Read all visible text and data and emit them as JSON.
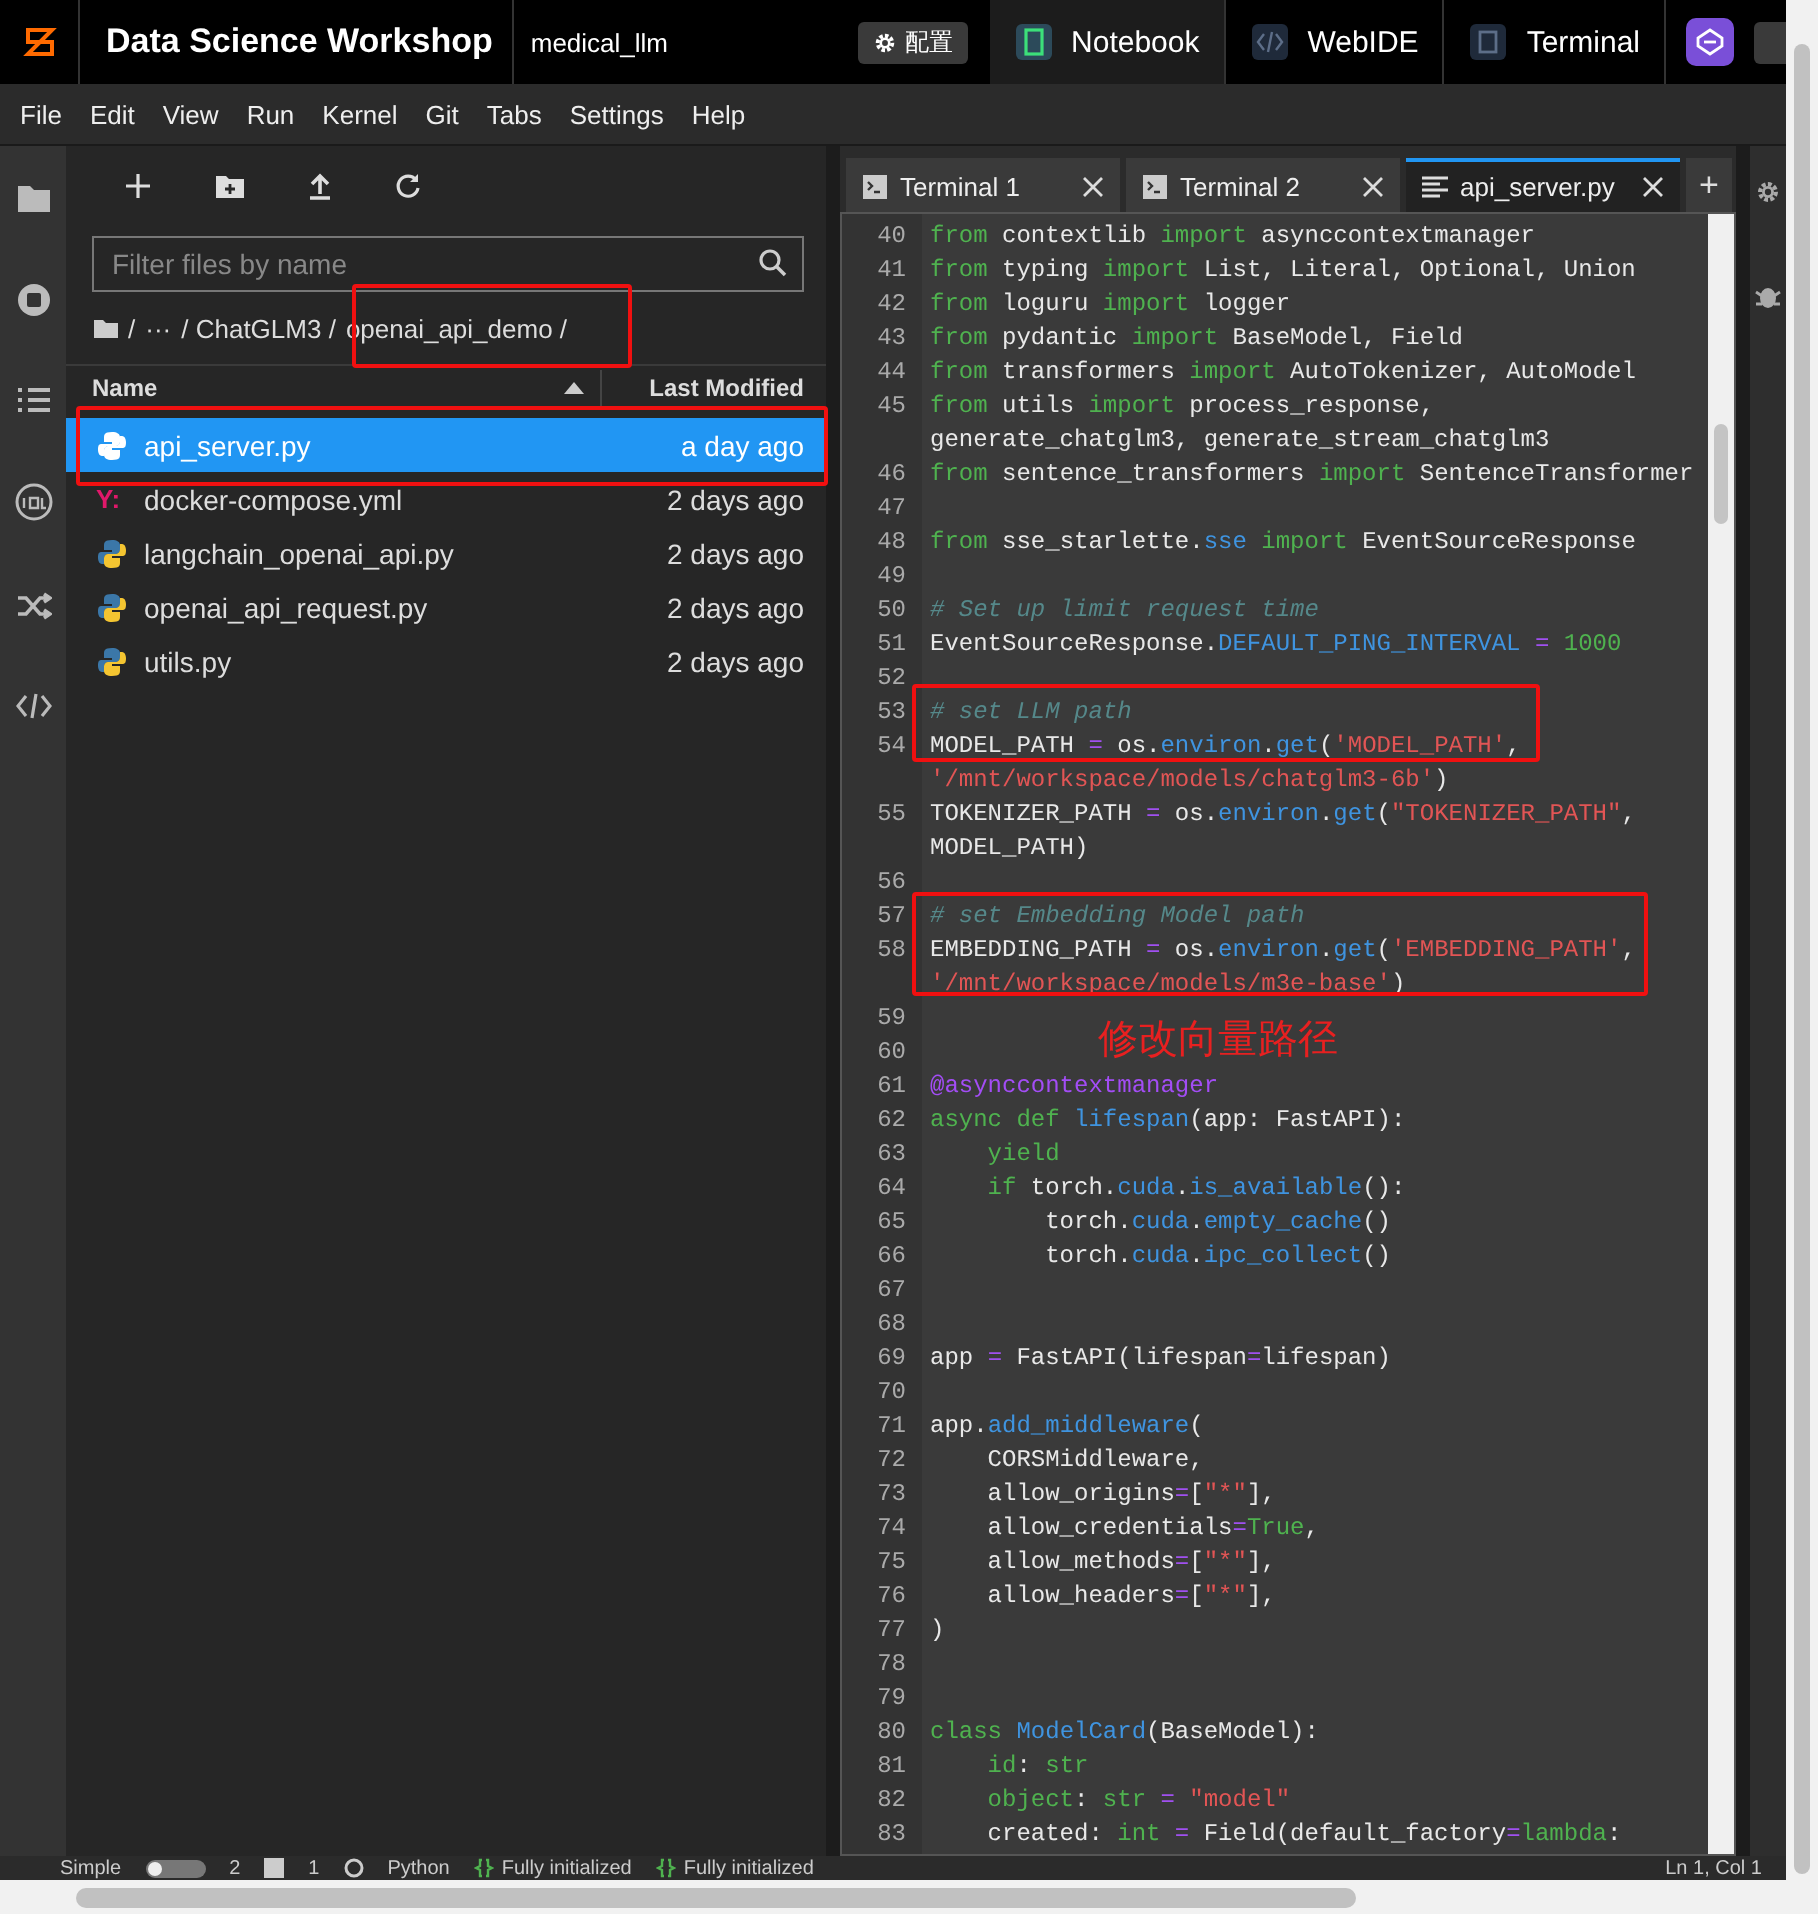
{
  "top_bar": {
    "title": "Data Science Workshop",
    "workspace": "medical_llm",
    "config_button": "配置",
    "tabs": [
      {
        "label": "Notebook",
        "kind": "notebook",
        "selected": true
      },
      {
        "label": "WebIDE",
        "kind": "webide",
        "selected": false
      },
      {
        "label": "Terminal",
        "kind": "terminal",
        "selected": false
      }
    ]
  },
  "menu": [
    "File",
    "Edit",
    "View",
    "Run",
    "Kernel",
    "Git",
    "Tabs",
    "Settings",
    "Help"
  ],
  "file_browser": {
    "filter": {
      "placeholder": "Filter files by name"
    },
    "breadcrumb": [
      "/",
      "···",
      "/ ChatGLM3 /",
      "openai_api_demo /"
    ],
    "columns": [
      "Name",
      "Last Modified"
    ],
    "files": [
      {
        "name": "api_server.py",
        "kind": "python",
        "modified": "a day ago",
        "selected": true
      },
      {
        "name": "docker-compose.yml",
        "kind": "yaml",
        "icon_glyph": "Y:",
        "modified": "2 days ago",
        "selected": false
      },
      {
        "name": "langchain_openai_api.py",
        "kind": "python",
        "modified": "2 days ago",
        "selected": false
      },
      {
        "name": "openai_api_request.py",
        "kind": "python",
        "modified": "2 days ago",
        "selected": false
      },
      {
        "name": "utils.py",
        "kind": "python",
        "modified": "2 days ago",
        "selected": false
      }
    ]
  },
  "editor": {
    "tabs": [
      {
        "label": "Terminal 1",
        "kind": "terminal",
        "selected": false
      },
      {
        "label": "Terminal 2",
        "kind": "terminal",
        "selected": false
      },
      {
        "label": "api_server.py",
        "kind": "file",
        "selected": true
      }
    ],
    "new_tab": "+",
    "lines": [
      {
        "number": "40",
        "tokens": [
          {
            "kind": "kw",
            "text": "from"
          },
          {
            "kind": "p",
            "text": " contextlib "
          },
          {
            "kind": "kw",
            "text": "import"
          },
          {
            "kind": "p",
            "text": " asynccontextmanager"
          }
        ]
      },
      {
        "number": "41",
        "tokens": [
          {
            "kind": "kw",
            "text": "from"
          },
          {
            "kind": "p",
            "text": " typing "
          },
          {
            "kind": "kw",
            "text": "import"
          },
          {
            "kind": "p",
            "text": " List, Literal, Optional, Union"
          }
        ]
      },
      {
        "number": "42",
        "tokens": [
          {
            "kind": "kw",
            "text": "from"
          },
          {
            "kind": "p",
            "text": " loguru "
          },
          {
            "kind": "kw",
            "text": "import"
          },
          {
            "kind": "p",
            "text": " logger"
          }
        ]
      },
      {
        "number": "43",
        "tokens": [
          {
            "kind": "kw",
            "text": "from"
          },
          {
            "kind": "p",
            "text": " pydantic "
          },
          {
            "kind": "kw",
            "text": "import"
          },
          {
            "kind": "p",
            "text": " BaseModel, Field"
          }
        ]
      },
      {
        "number": "44",
        "tokens": [
          {
            "kind": "kw",
            "text": "from"
          },
          {
            "kind": "p",
            "text": " transformers "
          },
          {
            "kind": "kw",
            "text": "import"
          },
          {
            "kind": "p",
            "text": " AutoTokenizer, AutoModel"
          }
        ]
      },
      {
        "number": "45",
        "tokens": [
          {
            "kind": "kw",
            "text": "from"
          },
          {
            "kind": "p",
            "text": " utils "
          },
          {
            "kind": "kw",
            "text": "import"
          },
          {
            "kind": "p",
            "text": " process_response,"
          }
        ]
      },
      {
        "tokens": [
          {
            "kind": "p",
            "text": "generate_chatglm3, generate_stream_chatglm3"
          }
        ]
      },
      {
        "number": "46",
        "tokens": [
          {
            "kind": "kw",
            "text": "from"
          },
          {
            "kind": "p",
            "text": " sentence_transformers "
          },
          {
            "kind": "kw",
            "text": "import"
          },
          {
            "kind": "p",
            "text": " SentenceTransformer"
          }
        ]
      },
      {
        "number": "47"
      },
      {
        "number": "48",
        "tokens": [
          {
            "kind": "kw",
            "text": "from"
          },
          {
            "kind": "p",
            "text": " sse_starlette."
          },
          {
            "kind": "attr",
            "text": "sse"
          },
          {
            "kind": "kw",
            "text": " import"
          },
          {
            "kind": "p",
            "text": " EventSourceResponse"
          }
        ]
      },
      {
        "number": "49"
      },
      {
        "number": "50",
        "tokens": [
          {
            "kind": "cm",
            "text": "# Set up limit request time"
          }
        ]
      },
      {
        "number": "51",
        "tokens": [
          {
            "kind": "p",
            "text": "EventSourceResponse."
          },
          {
            "kind": "attr",
            "text": "DEFAULT_PING_INTERVAL"
          },
          {
            "kind": "op",
            "text": " ="
          },
          {
            "kind": "num",
            "text": " 1000"
          }
        ]
      },
      {
        "number": "52"
      },
      {
        "number": "53",
        "tokens": [
          {
            "kind": "cm",
            "text": "# set LLM path"
          }
        ]
      },
      {
        "number": "54",
        "tokens": [
          {
            "kind": "p",
            "text": "MODEL_PATH "
          },
          {
            "kind": "op",
            "text": "="
          },
          {
            "kind": "p",
            "text": " os."
          },
          {
            "kind": "attr",
            "text": "environ"
          },
          {
            "kind": "p",
            "text": "."
          },
          {
            "kind": "attr",
            "text": "get"
          },
          {
            "kind": "p",
            "text": "("
          },
          {
            "kind": "str",
            "text": "'MODEL_PATH'"
          },
          {
            "kind": "p",
            "text": ","
          }
        ]
      },
      {
        "tokens": [
          {
            "kind": "str",
            "text": "'/mnt/workspace/models/chatglm3-6b'"
          },
          {
            "kind": "p",
            "text": ")"
          }
        ]
      },
      {
        "number": "55",
        "tokens": [
          {
            "kind": "p",
            "text": "TOKENIZER_PATH "
          },
          {
            "kind": "op",
            "text": "="
          },
          {
            "kind": "p",
            "text": " os."
          },
          {
            "kind": "attr",
            "text": "environ"
          },
          {
            "kind": "p",
            "text": "."
          },
          {
            "kind": "attr",
            "text": "get"
          },
          {
            "kind": "p",
            "text": "("
          },
          {
            "kind": "str",
            "text": "\"TOKENIZER_PATH\""
          },
          {
            "kind": "p",
            "text": ","
          }
        ]
      },
      {
        "tokens": [
          {
            "kind": "p",
            "text": "MODEL_PATH)"
          }
        ]
      },
      {
        "number": "56"
      },
      {
        "number": "57",
        "tokens": [
          {
            "kind": "cm",
            "text": "# set Embedding Model path"
          }
        ]
      },
      {
        "number": "58",
        "tokens": [
          {
            "kind": "p",
            "text": "EMBEDDING_PATH "
          },
          {
            "kind": "op",
            "text": "="
          },
          {
            "kind": "p",
            "text": " os."
          },
          {
            "kind": "attr",
            "text": "environ"
          },
          {
            "kind": "p",
            "text": "."
          },
          {
            "kind": "attr",
            "text": "get"
          },
          {
            "kind": "p",
            "text": "("
          },
          {
            "kind": "str",
            "text": "'EMBEDDING_PATH'"
          },
          {
            "kind": "p",
            "text": ","
          }
        ]
      },
      {
        "tokens": [
          {
            "kind": "str",
            "text": "'/mnt/workspace/models/m3e-base'"
          },
          {
            "kind": "p",
            "text": ")"
          }
        ]
      },
      {
        "number": "59"
      },
      {
        "number": "60"
      },
      {
        "number": "61",
        "tokens": [
          {
            "kind": "deco",
            "text": "@asynccontextmanager"
          }
        ]
      },
      {
        "number": "62",
        "tokens": [
          {
            "kind": "kw",
            "text": "async def"
          },
          {
            "kind": "attr",
            "text": " lifespan"
          },
          {
            "kind": "p",
            "text": "(app: FastAPI):"
          }
        ]
      },
      {
        "number": "63",
        "tokens": [
          {
            "kind": "kw",
            "text": "    yield"
          }
        ]
      },
      {
        "number": "64",
        "tokens": [
          {
            "kind": "kw",
            "text": "    if"
          },
          {
            "kind": "p",
            "text": " torch."
          },
          {
            "kind": "attr",
            "text": "cuda"
          },
          {
            "kind": "p",
            "text": "."
          },
          {
            "kind": "attr",
            "text": "is_available"
          },
          {
            "kind": "p",
            "text": "():"
          }
        ]
      },
      {
        "number": "65",
        "tokens": [
          {
            "kind": "p",
            "text": "        torch."
          },
          {
            "kind": "attr",
            "text": "cuda"
          },
          {
            "kind": "p",
            "text": "."
          },
          {
            "kind": "attr",
            "text": "empty_cache"
          },
          {
            "kind": "p",
            "text": "()"
          }
        ]
      },
      {
        "number": "66",
        "tokens": [
          {
            "kind": "p",
            "text": "        torch."
          },
          {
            "kind": "attr",
            "text": "cuda"
          },
          {
            "kind": "p",
            "text": "."
          },
          {
            "kind": "attr",
            "text": "ipc_collect"
          },
          {
            "kind": "p",
            "text": "()"
          }
        ]
      },
      {
        "number": "67"
      },
      {
        "number": "68"
      },
      {
        "number": "69",
        "tokens": [
          {
            "kind": "p",
            "text": "app "
          },
          {
            "kind": "op",
            "text": "="
          },
          {
            "kind": "p",
            "text": " FastAPI(lifespan"
          },
          {
            "kind": "op",
            "text": "="
          },
          {
            "kind": "p",
            "text": "lifespan)"
          }
        ]
      },
      {
        "number": "70"
      },
      {
        "number": "71",
        "tokens": [
          {
            "kind": "p",
            "text": "app."
          },
          {
            "kind": "attr",
            "text": "add_middleware"
          },
          {
            "kind": "p",
            "text": "("
          }
        ]
      },
      {
        "number": "72",
        "tokens": [
          {
            "kind": "p",
            "text": "    CORSMiddleware,"
          }
        ]
      },
      {
        "number": "73",
        "tokens": [
          {
            "kind": "p",
            "text": "    allow_origins"
          },
          {
            "kind": "op",
            "text": "="
          },
          {
            "kind": "p",
            "text": "["
          },
          {
            "kind": "str",
            "text": "\"*\""
          },
          {
            "kind": "p",
            "text": "],"
          }
        ]
      },
      {
        "number": "74",
        "tokens": [
          {
            "kind": "p",
            "text": "    allow_credentials"
          },
          {
            "kind": "op",
            "text": "="
          },
          {
            "kind": "kw",
            "text": "True"
          },
          {
            "kind": "p",
            "text": ","
          }
        ]
      },
      {
        "number": "75",
        "tokens": [
          {
            "kind": "p",
            "text": "    allow_methods"
          },
          {
            "kind": "op",
            "text": "="
          },
          {
            "kind": "p",
            "text": "["
          },
          {
            "kind": "str",
            "text": "\"*\""
          },
          {
            "kind": "p",
            "text": "],"
          }
        ]
      },
      {
        "number": "76",
        "tokens": [
          {
            "kind": "p",
            "text": "    allow_headers"
          },
          {
            "kind": "op",
            "text": "="
          },
          {
            "kind": "p",
            "text": "["
          },
          {
            "kind": "str",
            "text": "\"*\""
          },
          {
            "kind": "p",
            "text": "],"
          }
        ]
      },
      {
        "number": "77",
        "tokens": [
          {
            "kind": "p",
            "text": ")"
          }
        ]
      },
      {
        "number": "78"
      },
      {
        "number": "79"
      },
      {
        "number": "80",
        "tokens": [
          {
            "kind": "kw",
            "text": "class"
          },
          {
            "kind": "attr",
            "text": " ModelCard"
          },
          {
            "kind": "p",
            "text": "(BaseModel):"
          }
        ]
      },
      {
        "number": "81",
        "tokens": [
          {
            "kind": "kw",
            "text": "    id"
          },
          {
            "kind": "p",
            "text": ":"
          },
          {
            "kind": "kw",
            "text": " str"
          }
        ]
      },
      {
        "number": "82",
        "tokens": [
          {
            "kind": "kw",
            "text": "    object"
          },
          {
            "kind": "p",
            "text": ":"
          },
          {
            "kind": "kw",
            "text": " str"
          },
          {
            "kind": "op",
            "text": " ="
          },
          {
            "kind": "str",
            "text": " \"model\""
          }
        ]
      },
      {
        "number": "83",
        "tokens": [
          {
            "kind": "p",
            "text": "    created:"
          },
          {
            "kind": "kw",
            "text": " int"
          },
          {
            "kind": "op",
            "text": " ="
          },
          {
            "kind": "p",
            "text": " Field(default_factory"
          },
          {
            "kind": "op",
            "text": "="
          },
          {
            "kind": "kw",
            "text": "lambda"
          },
          {
            "kind": "p",
            "text": ":"
          }
        ]
      }
    ]
  },
  "annotation": "修改向量路径",
  "status_bar": {
    "mode": "Simple",
    "simple_on": false,
    "terminals": "2",
    "kernels": "1",
    "language": "Python",
    "lsp": [
      "Fully initialized",
      "Fully initialized"
    ],
    "cursor": "Ln 1, Col 1"
  }
}
